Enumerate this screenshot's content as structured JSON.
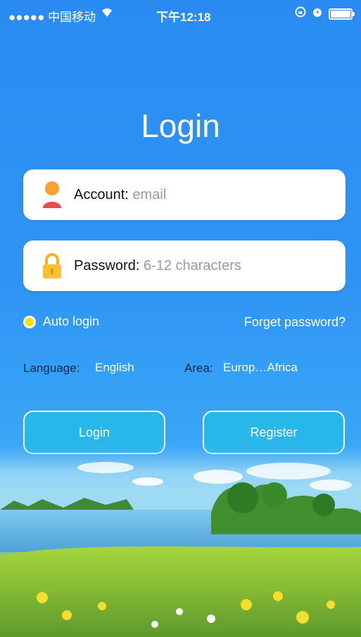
{
  "status_bar": {
    "carrier": "●●●●● 中国移动",
    "time": "下午12:18",
    "icons": [
      "wifi-icon",
      "rotation-lock-icon",
      "alarm-icon",
      "battery-icon"
    ]
  },
  "title": "Login",
  "account": {
    "label": "Account:",
    "placeholder": "email",
    "icon": "user-icon"
  },
  "password": {
    "label": "Password:",
    "placeholder": "6-12 characters",
    "icon": "lock-icon"
  },
  "auto_login": {
    "label": "Auto login"
  },
  "forget_password": "Forget password?",
  "language": {
    "label": "Language:",
    "value": "English"
  },
  "area": {
    "label": "Area:",
    "value": "Europ…Africa"
  },
  "buttons": {
    "login": "Login",
    "register": "Register"
  },
  "colors": {
    "background": "#2f95f5",
    "button": "#27b7ea",
    "radio": "#f4e400",
    "accent_label": "#132a45"
  }
}
